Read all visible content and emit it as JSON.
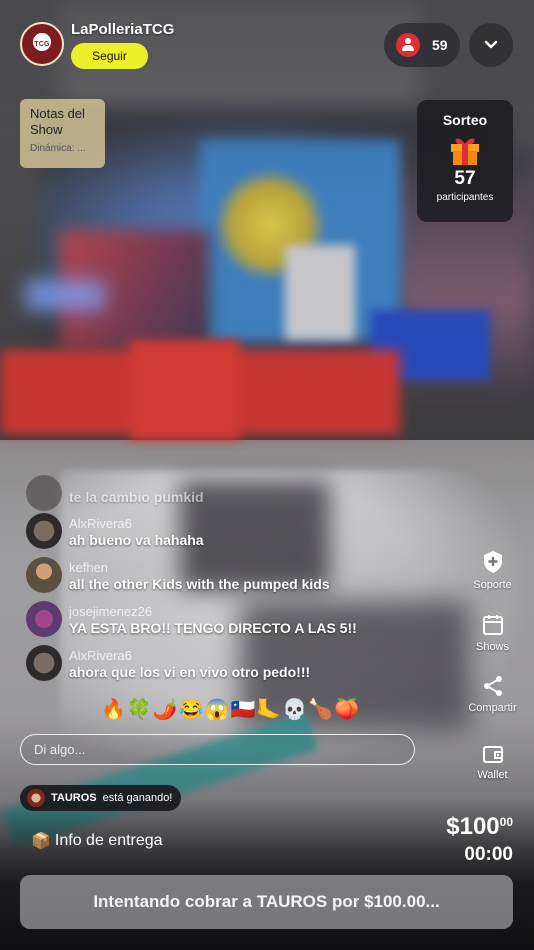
{
  "header": {
    "seller_name": "LaPolleriaTCG",
    "follow_label": "Seguir",
    "viewer_count": "59"
  },
  "notes": {
    "title": "Notas del Show",
    "subtitle": "Dinámica: ..."
  },
  "giveaway": {
    "title": "Sorteo",
    "count": "57",
    "label": "participantes"
  },
  "chat": {
    "messages": [
      {
        "user": "",
        "text": "te la cambio pumkid"
      },
      {
        "user": "AlxRivera6",
        "text": "ah bueno va hahaha"
      },
      {
        "user": "kefhen",
        "text": "all the other Kids with the pumped kids"
      },
      {
        "user": "josejimenez26",
        "text": "YA ESTA BRO!! TENGO DIRECTO A LAS 5!!"
      },
      {
        "user": "AlxRivera6",
        "text": "ahora que los vi en vivo otro pedo!!!"
      }
    ],
    "emojis": "🔥🍀🌶️😂😱🇨🇱🦶💀🍗🍑",
    "input_placeholder": "Di algo..."
  },
  "actions": {
    "support": "Soporte",
    "shows": "Shows",
    "share": "Compartir",
    "wallet": "Wallet"
  },
  "auction": {
    "winner_name": "TAUROS",
    "winner_status": "está ganando!",
    "delivery_label": "Info de entrega",
    "price_main": "$100",
    "price_cents": "00",
    "timer": "00:00",
    "cta_label": "Intentando cobrar a TAUROS por $100.00..."
  },
  "colors": {
    "follow_button": "#ecf029",
    "viewer_icon": "#e02d3c"
  }
}
